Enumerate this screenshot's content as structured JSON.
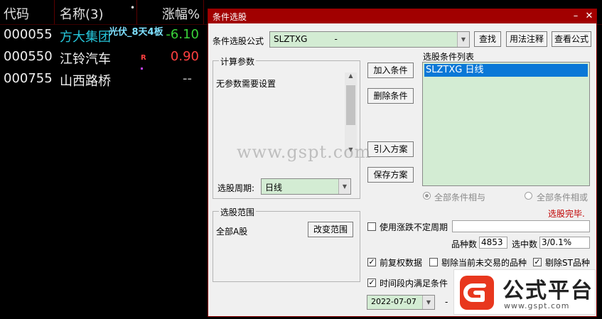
{
  "table": {
    "headers": {
      "code": "代码",
      "name": "名称(3)",
      "dot": "•",
      "change": "涨幅%"
    },
    "rows": [
      {
        "code": "000055",
        "name": "方大集团",
        "tag": "光伏_8天4板",
        "change": "-6.10",
        "name_color": "#26c6da",
        "change_color": "#3ad23a"
      },
      {
        "code": "000550",
        "name": "江铃汽车",
        "tag": "R",
        "change": "0.90",
        "name_color": "#f0f0f0",
        "change_color": "#ff4040"
      },
      {
        "code": "000755",
        "name": "山西路桥",
        "tag": "",
        "change": "--",
        "name_color": "#f0f0f0",
        "change_color": "#c0c0c0"
      }
    ]
  },
  "dialog": {
    "title": "条件选股",
    "formula_label": "条件选股公式",
    "formula_value": "SLZTXG          -",
    "buttons": {
      "find": "查找",
      "usage": "用法注释",
      "view": "查看公式",
      "add": "加入条件",
      "delete": "删除条件",
      "import": "引入方案",
      "save": "保存方案",
      "change_range": "改变范围"
    },
    "params": {
      "title": "计算参数",
      "text": "无参数需要设置",
      "period_label": "选股周期:",
      "period_value": "日线"
    },
    "conditions": {
      "title": "选股条件列表",
      "items": [
        "SLZTXG  日线"
      ]
    },
    "radio": {
      "and": "全部条件相与",
      "or": "全部条件相或"
    },
    "status": "选股完毕.",
    "range": {
      "title": "选股范围",
      "value": "全部A股"
    },
    "use_period_label": "使用涨跌不定周期",
    "stats": {
      "count_label": "品种数",
      "count_value": "4853",
      "selected_label": "选中数",
      "selected_value": "3/0.1%"
    },
    "options": {
      "adjust": "前复权数据",
      "exclude_untraded": "剔除当前未交易的品种",
      "exclude_st": "剔除ST品种",
      "time_range": "时间段内满足条件"
    },
    "date_value": "2022-07-07",
    "date_dash": "-"
  },
  "watermark": "www.gspt.com",
  "logo": {
    "main": "公式平台",
    "url": "www.gspt.com"
  },
  "colors": {
    "titlebar": "#a10000",
    "accent": "#0a78d7",
    "green_field": "#d3ecd3",
    "status": "#c00000"
  }
}
